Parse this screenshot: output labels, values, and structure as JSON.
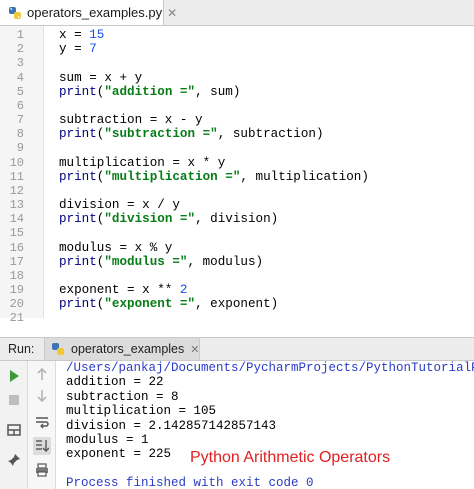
{
  "editor_tab": {
    "filename": "operators_examples.py",
    "close_glyph": "✕"
  },
  "editor": {
    "lines": [
      {
        "n": "1",
        "tokens": [
          {
            "t": "x = ",
            "c": ""
          },
          {
            "t": "15",
            "c": "num"
          }
        ]
      },
      {
        "n": "2",
        "tokens": [
          {
            "t": "y = ",
            "c": ""
          },
          {
            "t": "7",
            "c": "num"
          }
        ]
      },
      {
        "n": "3",
        "tokens": []
      },
      {
        "n": "4",
        "tokens": [
          {
            "t": "sum = x + y",
            "c": ""
          }
        ]
      },
      {
        "n": "5",
        "tokens": [
          {
            "t": "print",
            "c": "bi"
          },
          {
            "t": "(",
            "c": ""
          },
          {
            "t": "\"addition =\"",
            "c": "str"
          },
          {
            "t": ", sum)",
            "c": ""
          }
        ]
      },
      {
        "n": "6",
        "tokens": []
      },
      {
        "n": "7",
        "tokens": [
          {
            "t": "subtraction = x - y",
            "c": ""
          }
        ]
      },
      {
        "n": "8",
        "tokens": [
          {
            "t": "print",
            "c": "bi"
          },
          {
            "t": "(",
            "c": ""
          },
          {
            "t": "\"subtraction =\"",
            "c": "str"
          },
          {
            "t": ", subtraction)",
            "c": ""
          }
        ]
      },
      {
        "n": "9",
        "tokens": []
      },
      {
        "n": "10",
        "tokens": [
          {
            "t": "multiplication = x * y",
            "c": ""
          }
        ]
      },
      {
        "n": "11",
        "tokens": [
          {
            "t": "print",
            "c": "bi"
          },
          {
            "t": "(",
            "c": ""
          },
          {
            "t": "\"multiplication =\"",
            "c": "str"
          },
          {
            "t": ", multiplication)",
            "c": ""
          }
        ]
      },
      {
        "n": "12",
        "tokens": []
      },
      {
        "n": "13",
        "tokens": [
          {
            "t": "division = x / y",
            "c": ""
          }
        ]
      },
      {
        "n": "14",
        "tokens": [
          {
            "t": "print",
            "c": "bi"
          },
          {
            "t": "(",
            "c": ""
          },
          {
            "t": "\"division =\"",
            "c": "str"
          },
          {
            "t": ", division)",
            "c": ""
          }
        ]
      },
      {
        "n": "15",
        "tokens": []
      },
      {
        "n": "16",
        "tokens": [
          {
            "t": "modulus = x % y",
            "c": ""
          }
        ]
      },
      {
        "n": "17",
        "tokens": [
          {
            "t": "print",
            "c": "bi"
          },
          {
            "t": "(",
            "c": ""
          },
          {
            "t": "\"modulus =\"",
            "c": "str"
          },
          {
            "t": ", modulus)",
            "c": ""
          }
        ]
      },
      {
        "n": "18",
        "tokens": []
      },
      {
        "n": "19",
        "tokens": [
          {
            "t": "exponent = x ** ",
            "c": ""
          },
          {
            "t": "2",
            "c": "num"
          }
        ]
      },
      {
        "n": "20",
        "tokens": [
          {
            "t": "print",
            "c": "bi"
          },
          {
            "t": "(",
            "c": ""
          },
          {
            "t": "\"exponent =\"",
            "c": "str"
          },
          {
            "t": ", exponent)",
            "c": ""
          }
        ]
      },
      {
        "n": "21",
        "tokens": []
      }
    ]
  },
  "run_panel": {
    "label": "Run:",
    "tab_name": "operators_examples",
    "close_glyph": "✕",
    "console_lines": [
      {
        "text": "/Users/pankaj/Documents/PycharmProjects/PythonTutorialPro/venv",
        "kind": "path"
      },
      {
        "text": "addition = 22",
        "kind": "out"
      },
      {
        "text": "subtraction = 8",
        "kind": "out"
      },
      {
        "text": "multiplication = 105",
        "kind": "out"
      },
      {
        "text": "division = 2.142857142857143",
        "kind": "out"
      },
      {
        "text": "modulus = 1",
        "kind": "out"
      },
      {
        "text": "exponent = 225",
        "kind": "out"
      },
      {
        "text": "",
        "kind": "out"
      },
      {
        "text": "Process finished with exit code 0",
        "kind": "finished"
      }
    ],
    "caption": "Python Arithmetic Operators"
  },
  "colors": {
    "number": "#1750eb",
    "string": "#067d17",
    "builtin": "#000080",
    "console_info": "#2a3cc7",
    "caption": "#e02020",
    "run_green": "#3f9a3f"
  },
  "icons": {
    "file_icon": "python-file-icon",
    "toolbar_left": [
      "run-icon",
      "stop-icon",
      "layout-icon",
      "pin-icon"
    ],
    "toolbar_right": [
      "up-arrow-icon",
      "down-arrow-icon",
      "soft-wrap-icon",
      "scroll-to-end-icon",
      "print-icon",
      "trash-icon"
    ]
  }
}
